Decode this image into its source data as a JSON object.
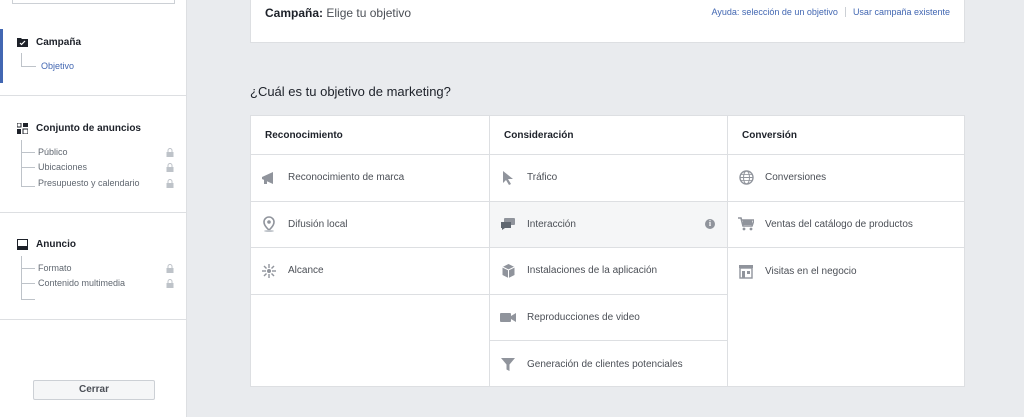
{
  "sidebar": {
    "campaign": {
      "label": "Campaña",
      "sub": "Objetivo"
    },
    "adset": {
      "label": "Conjunto de anuncios",
      "items": [
        "Público",
        "Ubicaciones",
        "Presupuesto y calendario"
      ]
    },
    "ad": {
      "label": "Anuncio",
      "items": [
        "Formato",
        "Contenido multimedia"
      ]
    },
    "close_label": "Cerrar"
  },
  "header": {
    "title_bold": "Campaña:",
    "title_rest": "Elige tu objetivo",
    "link_help": "Ayuda: selección de un objetivo",
    "link_existing": "Usar campaña existente"
  },
  "question": "¿Cuál es tu objetivo de marketing?",
  "columns": [
    {
      "title": "Reconocimiento",
      "items": [
        "Reconocimiento de marca",
        "Difusión local",
        "Alcance"
      ]
    },
    {
      "title": "Consideración",
      "items": [
        "Tráfico",
        "Interacción",
        "Instalaciones de la aplicación",
        "Reproducciones de video",
        "Generación de clientes potenciales"
      ]
    },
    {
      "title": "Conversión",
      "items": [
        "Conversiones",
        "Ventas del catálogo de productos",
        "Visitas en el negocio"
      ]
    }
  ],
  "info_glyph": "i",
  "colors": {
    "accent": "#4267b2",
    "icon": "#90949c",
    "border": "#dddfe2"
  }
}
